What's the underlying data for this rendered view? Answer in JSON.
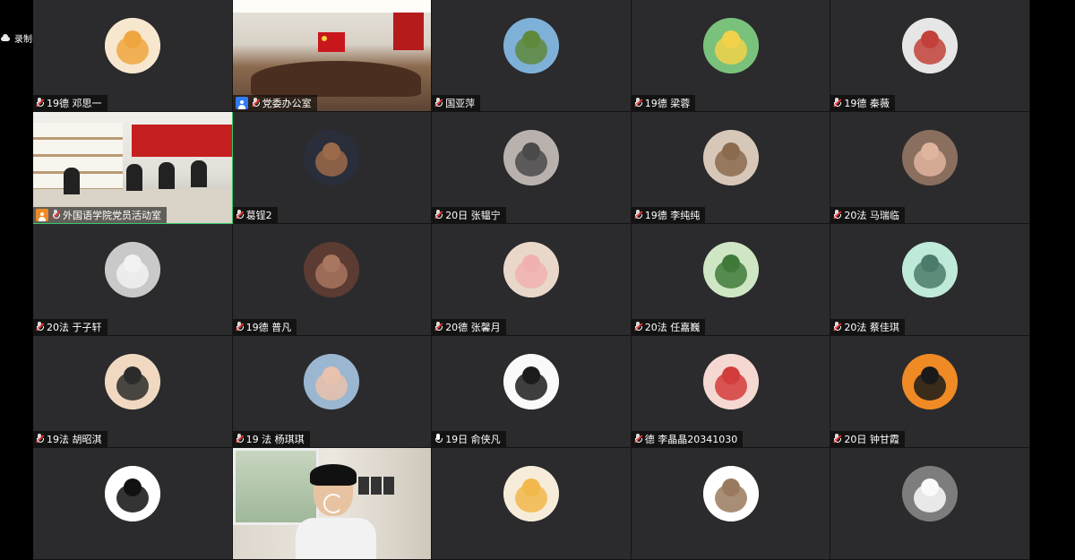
{
  "recording": {
    "label": "录制中"
  },
  "tiles": [
    {
      "name": "19德 邓思一",
      "avatar": "cat-cartoon",
      "bg": "#f7e7cf",
      "fg": "#f0a640"
    },
    {
      "name": "党委办公室",
      "video": "office",
      "host": true
    },
    {
      "name": "国亚萍",
      "avatar": "landscape",
      "bg": "#7fb0d8",
      "fg": "#5f8a3c"
    },
    {
      "name": "19德 梁蓉",
      "avatar": "cartoon-boy",
      "bg": "#7ac27b",
      "fg": "#f2d24b"
    },
    {
      "name": "19德 秦薇",
      "avatar": "building",
      "bg": "#e6e6e6",
      "fg": "#c2413a"
    },
    {
      "name": "外国语学院党员活动室",
      "video": "meeting",
      "host": true,
      "active": true
    },
    {
      "name": "葛锃2",
      "avatar": "man-photo",
      "bg": "#2a2d3a",
      "fg": "#9b6a4a"
    },
    {
      "name": "20日 张韫宁",
      "avatar": "cat-photo",
      "bg": "#b9b1ad",
      "fg": "#4a4a4a"
    },
    {
      "name": "19德 李纯纯",
      "avatar": "cat-hug",
      "bg": "#d7c7b8",
      "fg": "#8b6a4e"
    },
    {
      "name": "20法 马瑞临",
      "avatar": "woman-photo",
      "bg": "#8a6e5e",
      "fg": "#e0b59e"
    },
    {
      "name": "20法 于子轩",
      "avatar": "white-cat",
      "bg": "#c9c9c9",
      "fg": "#f2f2f2"
    },
    {
      "name": "19德 普凡",
      "avatar": "face-closeup",
      "bg": "#5b3b32",
      "fg": "#a9765f"
    },
    {
      "name": "20德 张馨月",
      "avatar": "pink-cat",
      "bg": "#e9d8c9",
      "fg": "#f1b1b1"
    },
    {
      "name": "20法 任嘉巍",
      "avatar": "plant-drawing",
      "bg": "#cfe6c4",
      "fg": "#3f7a3a"
    },
    {
      "name": "20法 蔡佳琪",
      "avatar": "girl-drawing",
      "bg": "#bfe9d8",
      "fg": "#4c7b6b"
    },
    {
      "name": "19法 胡昭淇",
      "avatar": "girl-sketch",
      "bg": "#f0d9c0",
      "fg": "#2b2b2b"
    },
    {
      "name": "19 法 杨琪琪",
      "avatar": "girl-photo",
      "bg": "#9ab6d0",
      "fg": "#e9c2ad"
    },
    {
      "name": "19日 俞侠凡",
      "avatar": "dog-face",
      "bg": "#fafafa",
      "fg": "#1c1c1c",
      "mic_on": true
    },
    {
      "name": "德 李晶晶20341030",
      "avatar": "pig-hat",
      "bg": "#f5d8d2",
      "fg": "#d33c3c"
    },
    {
      "name": "20日 钟甘霞",
      "avatar": "tiger",
      "bg": "#f08a24",
      "fg": "#1a1a1a"
    },
    {
      "name": "",
      "avatar": "rabbit",
      "bg": "#ffffff",
      "fg": "#111111"
    },
    {
      "name": "",
      "video": "room",
      "loading": true
    },
    {
      "name": "",
      "avatar": "egg",
      "bg": "#f7ecd9",
      "fg": "#f2b84b"
    },
    {
      "name": "",
      "avatar": "dog-frame",
      "bg": "#ffffff",
      "fg": "#9a7a5e"
    },
    {
      "name": "",
      "avatar": "cat-illustration",
      "bg": "#7d7d7d",
      "fg": "#fafafa"
    }
  ]
}
